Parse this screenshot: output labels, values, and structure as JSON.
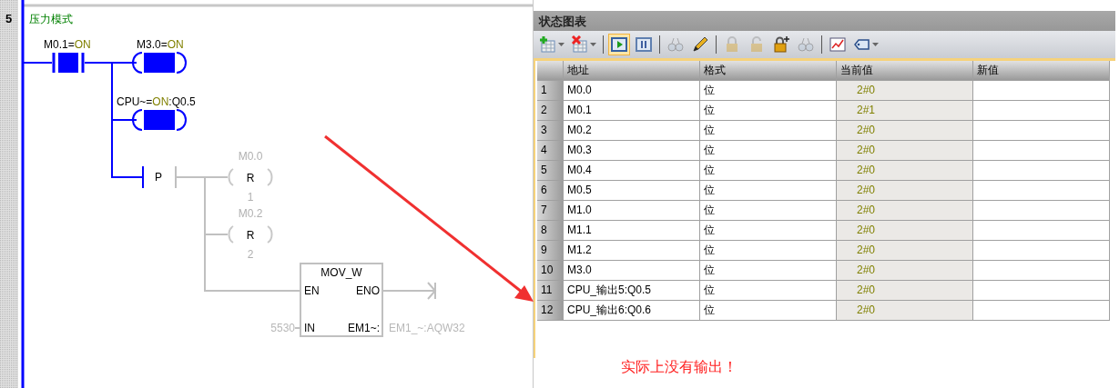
{
  "network": {
    "number": "5",
    "comment": "压力模式",
    "elements": [
      {
        "kind": "contact",
        "label": "M0.1=",
        "value": "ON",
        "energized": true
      },
      {
        "kind": "coil",
        "label": "M3.0=",
        "value": "ON",
        "energized": true
      },
      {
        "kind": "coil",
        "label": "CPU~=",
        "value": "ON",
        "suffix": ":Q0.5",
        "energized": true
      },
      {
        "kind": "edge",
        "letter": "P",
        "energized": false
      },
      {
        "kind": "reset",
        "address": "M0.0",
        "letter": "R",
        "count": "1",
        "energized": false
      },
      {
        "kind": "reset",
        "address": "M0.2",
        "letter": "R",
        "count": "2",
        "energized": false
      },
      {
        "kind": "box",
        "title": "MOV_W",
        "en": "EN",
        "eno": "ENO",
        "in": "IN",
        "out": "EM1~:",
        "in_value": "5530",
        "out_value": "EM1_~:AQW32",
        "energized": false
      }
    ]
  },
  "status_chart": {
    "title": "状态图表",
    "toolbar": [
      {
        "kind": "add-row",
        "selected": false,
        "disabled": false,
        "dropdown": true
      },
      {
        "kind": "delete-row",
        "selected": false,
        "disabled": false,
        "dropdown": true
      },
      {
        "kind": "separator"
      },
      {
        "kind": "play",
        "selected": true,
        "disabled": false
      },
      {
        "kind": "pause",
        "selected": false,
        "disabled": false
      },
      {
        "kind": "separator"
      },
      {
        "kind": "glasses",
        "selected": false,
        "disabled": true
      },
      {
        "kind": "pencil",
        "selected": false,
        "disabled": false
      },
      {
        "kind": "separator"
      },
      {
        "kind": "lock",
        "selected": false,
        "disabled": true
      },
      {
        "kind": "unlock",
        "selected": false,
        "disabled": true
      },
      {
        "kind": "lock-plus",
        "selected": false,
        "disabled": false
      },
      {
        "kind": "glasses",
        "selected": false,
        "disabled": true
      },
      {
        "kind": "separator"
      },
      {
        "kind": "chart",
        "selected": false,
        "disabled": false
      },
      {
        "kind": "tag",
        "selected": false,
        "disabled": false,
        "dropdown": true
      }
    ],
    "columns": [
      "地址",
      "格式",
      "当前值",
      "新值"
    ],
    "rows": [
      {
        "number": "1",
        "address": "M0.0",
        "format": "位",
        "current_value": "2#0"
      },
      {
        "number": "2",
        "address": "M0.1",
        "format": "位",
        "current_value": "2#1"
      },
      {
        "number": "3",
        "address": "M0.2",
        "format": "位",
        "current_value": "2#0"
      },
      {
        "number": "4",
        "address": "M0.3",
        "format": "位",
        "current_value": "2#0"
      },
      {
        "number": "5",
        "address": "M0.4",
        "format": "位",
        "current_value": "2#0"
      },
      {
        "number": "6",
        "address": "M0.5",
        "format": "位",
        "current_value": "2#0"
      },
      {
        "number": "7",
        "address": "M1.0",
        "format": "位",
        "current_value": "2#0"
      },
      {
        "number": "8",
        "address": "M1.1",
        "format": "位",
        "current_value": "2#0"
      },
      {
        "number": "9",
        "address": "M1.2",
        "format": "位",
        "current_value": "2#0"
      },
      {
        "number": "10",
        "address": "M3.0",
        "format": "位",
        "current_value": "2#0"
      },
      {
        "number": "11",
        "address": "CPU_输出5:Q0.5",
        "format": "位",
        "current_value": "2#0"
      },
      {
        "number": "12",
        "address": "CPU_输出6:Q0.6",
        "format": "位",
        "current_value": "2#0"
      }
    ]
  },
  "annotation": {
    "note": "实际上没有输出！"
  }
}
